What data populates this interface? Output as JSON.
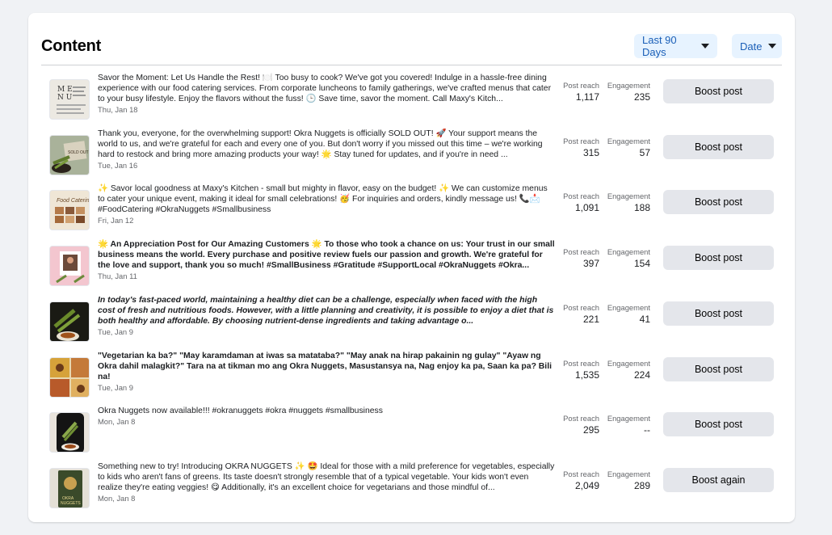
{
  "content": {
    "title": "Content",
    "range_dropdown": "Last 90 Days",
    "sort_dropdown": "Date",
    "labels": {
      "reach": "Post reach",
      "engagement": "Engagement"
    },
    "posts": [
      {
        "text": "Savor the Moment: Let Us Handle the Rest! 🍽️ Too busy to cook? We've got you covered! Indulge in a hassle-free dining experience with our food catering services. From corporate luncheons to family gatherings, we've crafted menus that cater to your busy lifestyle. Enjoy the flavors without the fuss! 🕒 Save time, savor the moment. Call Maxy's Kitch...",
        "date": "Thu, Jan 18",
        "reach": "1,117",
        "engagement": "235",
        "button": "Boost post",
        "style": "normal",
        "thumb": "menu-thumbnail"
      },
      {
        "text": "Thank you, everyone, for the overwhelming support! Okra Nuggets is officially SOLD OUT! 🚀 Your support means the world to us, and we're grateful for each and every one of you. But don't worry if you missed out this time – we're working hard to restock and bring more amazing products your way! 🌟 Stay tuned for updates, and if you're in need ...",
        "date": "Tue, Jan 16",
        "reach": "315",
        "engagement": "57",
        "button": "Boost post",
        "style": "normal",
        "thumb": "soldout-thumbnail"
      },
      {
        "text": "✨ Savor local goodness at Maxy's Kitchen - small but mighty in flavor, easy on the budget! ✨ We can customize menus to cater your unique event, making it ideal for small celebrations! 🥳 For inquiries and orders, kindly message us! 📞📩 #FoodCatering #OkraNuggets #Smallbusiness",
        "date": "Fri, Jan 12",
        "reach": "1,091",
        "engagement": "188",
        "button": "Boost post",
        "style": "normal",
        "thumb": "catering-thumbnail"
      },
      {
        "text": "🌟 An Appreciation Post for Our Amazing Customers 🌟 To those who took a chance on us: Your trust in our small business means the world. Every purchase and positive review fuels our passion and growth. We're grateful for the love and support, thank you so much! #SmallBusiness #Gratitude #SupportLocal #OkraNuggets #Okra...",
        "date": "Thu, Jan 11",
        "reach": "397",
        "engagement": "154",
        "button": "Boost post",
        "style": "bold",
        "thumb": "appreciation-thumbnail"
      },
      {
        "text": "In today's fast-paced world, maintaining a healthy diet can be a challenge, especially when faced with the high cost of fresh and nutritious foods. However, with a little planning and creativity, it is possible to enjoy a diet that is both healthy and affordable. By choosing nutrient-dense ingredients and taking advantage o...",
        "date": "Tue, Jan 9",
        "reach": "221",
        "engagement": "41",
        "button": "Boost post",
        "style": "bolditalic",
        "thumb": "okra-dish-thumbnail"
      },
      {
        "text": "\"Vegetarian ka ba?\" \"May karamdaman at iwas sa matataba?\" \"May anak na hirap pakainin ng gulay\" \"Ayaw ng Okra dahil malagkit?\" Tara na at tikman mo ang Okra Nuggets, Masustansya na, Nag enjoy ka pa, Saan ka pa? Bili na!",
        "date": "Tue, Jan 9",
        "reach": "1,535",
        "engagement": "224",
        "button": "Boost post",
        "style": "bold",
        "thumb": "collage-thumbnail"
      },
      {
        "text": "Okra Nuggets now available!!! #okranuggets #okra #nuggets #smallbusiness",
        "date": "Mon, Jan 8",
        "reach": "295",
        "engagement": "--",
        "button": "Boost post",
        "style": "normal",
        "thumb": "nuggets-thumbnail"
      },
      {
        "text": "Something new to try! Introducing OKRA NUGGETS ✨ 🤩 Ideal for those with a mild preference for vegetables, especially to kids who aren't fans of greens. Its taste doesn't strongly resemble that of a typical vegetable. Your kids won't even realize they're eating veggies! 😋 Additionally, it's an excellent choice for vegetarians and those mindful of...",
        "date": "Mon, Jan 8",
        "reach": "2,049",
        "engagement": "289",
        "button": "Boost again",
        "style": "normal",
        "thumb": "poster-thumbnail"
      }
    ]
  }
}
